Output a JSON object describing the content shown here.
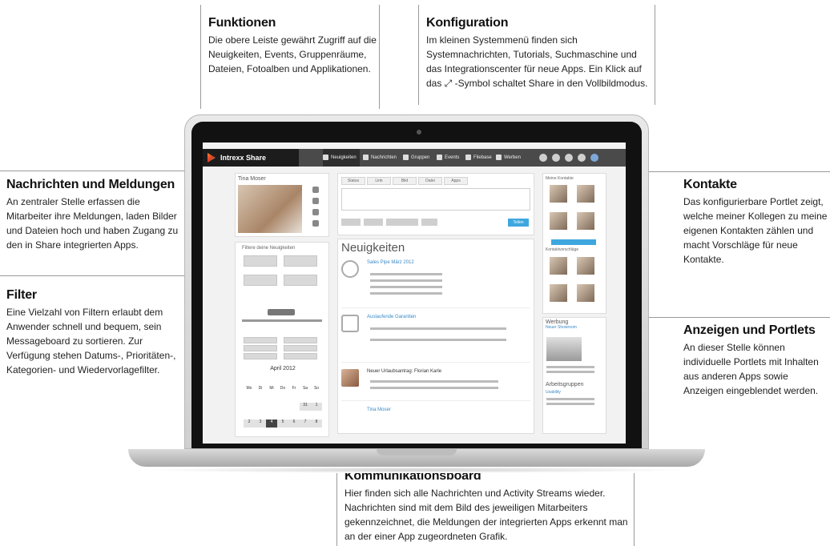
{
  "callouts": {
    "funktionen": {
      "title": "Funktionen",
      "text": "Die obere Leiste gewährt Zugriff auf die Neuigkeiten, Events, Gruppenräume, Dateien, Fotoalben und Applikationen."
    },
    "konfiguration": {
      "title": "Konfiguration",
      "text": "Im kleinen Systemmenü finden sich Systemnachrichten, Tutorials, Suchmaschine und das Integrationscenter für neue Apps. Ein Klick auf das ⤢ -Symbol schaltet Share in den Vollbildmodus."
    },
    "nachrichten": {
      "title": "Nachrichten und Meldungen",
      "text": "An zentraler Stelle erfassen die Mitarbeiter ihre Meldungen, laden Bilder und Dateien hoch und haben Zugang zu den in Share integrierten Apps."
    },
    "filter": {
      "title": "Filter",
      "text": "Eine Vielzahl von Filtern erlaubt dem Anwender schnell und bequem, sein Messageboard zu sortieren. Zur Verfügung stehen Datums-, Prioritäten-, Kategorien- und Wiedervorlagefilter."
    },
    "kontakte": {
      "title": "Kontakte",
      "text": "Das konfigurierbare Portlet zeigt, welche meiner Kollegen zu meine eigenen Kontakten zählen und macht Vorschläge für neue Kontakte."
    },
    "anzeigen": {
      "title": "Anzeigen und Portlets",
      "text": "An dieser Stelle können individuelle Portlets mit Inhalten aus anderen Apps sowie Anzeigen eingeblendet werden."
    },
    "board": {
      "title": "Kommunikationsboard",
      "text": "Hier finden sich alle Nachrichten und Activity Streams wieder. Nachrichten sind mit dem Bild des jeweiligen Mitarbeiters gekennzeichnet, die Meldungen der integrierten Apps erkennt man an der einer App zugeordneten Grafik."
    }
  },
  "app": {
    "logo": "Intrexx Share",
    "nav": [
      "Neuigkeiten",
      "Nachrichten",
      "Gruppen",
      "Events",
      "Filebase",
      "Werben"
    ],
    "profile_name": "Tina Moser",
    "filter_title": "Filtere deine Neuigkeiten",
    "calendar_title": "April 2012",
    "weekdays": [
      "Mo",
      "Di",
      "Mi",
      "Do",
      "Fr",
      "Sa",
      "So"
    ],
    "calendar_days": [
      "",
      "",
      "",
      "",
      "",
      "31",
      "1",
      "2",
      "3",
      "4",
      "5",
      "6",
      "7",
      "8"
    ],
    "status_tabs": [
      "Status",
      "Link",
      "Bild",
      "Datei",
      "Apps"
    ],
    "post_label": "Teilen",
    "feed_title": "Neuigkeiten",
    "feed_items": [
      "Sales Pipe März 2012",
      "Auslaufende Garantien",
      "Neuer Urlaubsantrag: Florian Karle",
      "Tina Moser"
    ],
    "contacts_title": "Meine Kontakte",
    "suggestions_title": "Kontaktvorschläge",
    "ads_title": "Werbung",
    "ads_sub": "Neuer Showroom",
    "groups_title": "Arbeitsgruppen",
    "groups_sub": "Usability"
  }
}
